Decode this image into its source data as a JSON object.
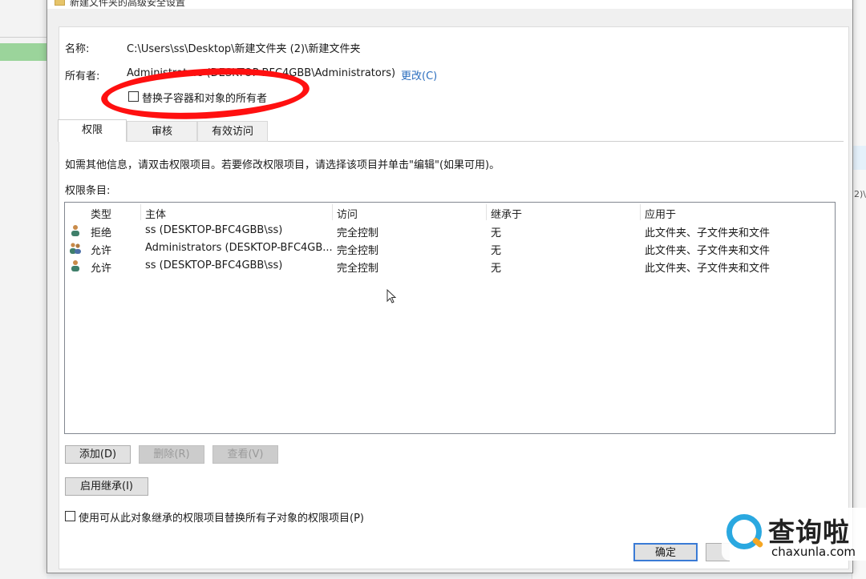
{
  "window": {
    "title": "新建文件夹的高级安全设置",
    "maximize_glyph": "☐",
    "close_glyph": "✕"
  },
  "name_label": "名称:",
  "name_value": "C:\\Users\\ss\\Desktop\\新建文件夹 (2)\\新建文件夹",
  "owner_label": "所有者:",
  "owner_value": "Administrators (DESKTOP-BFC4GBB\\Administrators)",
  "owner_change_link": "更改(C)",
  "replace_owner_checkbox": {
    "label": "替换子容器和对象的所有者",
    "checked": false
  },
  "tabs": [
    {
      "label": "权限",
      "active": true
    },
    {
      "label": "审核",
      "active": false
    },
    {
      "label": "有效访问",
      "active": false
    }
  ],
  "info_text": "如需其他信息，请双击权限项目。若要修改权限项目，请选择该项目并单击\"编辑\"(如果可用)。",
  "entries_label": "权限条目:",
  "columns": [
    "类型",
    "主体",
    "访问",
    "继承于",
    "应用于"
  ],
  "rows": [
    {
      "icon": "single-user-icon",
      "type": "拒绝",
      "principal": "ss (DESKTOP-BFC4GBB\\ss)",
      "access": "完全控制",
      "inherited": "无",
      "applies": "此文件夹、子文件夹和文件"
    },
    {
      "icon": "group-users-icon",
      "type": "允许",
      "principal": "Administrators (DESKTOP-BFC4GB...",
      "access": "完全控制",
      "inherited": "无",
      "applies": "此文件夹、子文件夹和文件"
    },
    {
      "icon": "single-user-icon",
      "type": "允许",
      "principal": "ss (DESKTOP-BFC4GBB\\ss)",
      "access": "完全控制",
      "inherited": "无",
      "applies": "此文件夹、子文件夹和文件"
    }
  ],
  "buttons": {
    "add": "添加(D)",
    "remove": "删除(R)",
    "view": "查看(V)",
    "enable_inheritance": "启用继承(I)",
    "ok": "确定"
  },
  "replace_child_checkbox": {
    "label": "使用可从此对象继承的权限项目替换所有子对象的权限项目(P)",
    "checked": false
  },
  "watermark": {
    "chinese": "查询啦",
    "url": "chaxunla.com"
  },
  "background_fragment": "2)\\",
  "colors": {
    "annotation": "#ff1010",
    "link": "#2d6fbf",
    "default_button_border": "#3a7bd5"
  }
}
